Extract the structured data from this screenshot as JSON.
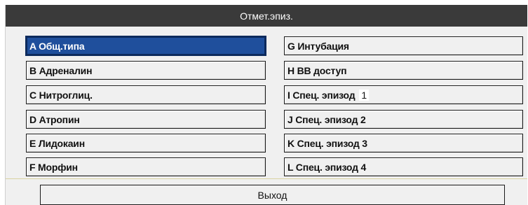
{
  "dialog": {
    "title": "Отмет.эпиз.",
    "left_buttons": [
      {
        "label": "A Общ.типа",
        "selected": true
      },
      {
        "label": "B Адреналин"
      },
      {
        "label": "C Нитроглиц."
      },
      {
        "label": "D Атропин"
      },
      {
        "label": "E Лидокаин"
      },
      {
        "label": "F Морфин"
      }
    ],
    "right_buttons": [
      {
        "label": "G Интубация"
      },
      {
        "label": "H ВВ доступ"
      },
      {
        "label": "I  Спец. эпизод",
        "badge": "1"
      },
      {
        "label": "J Спец. эпизод 2"
      },
      {
        "label": "K Спец. эпизод 3"
      },
      {
        "label": "L Спец. эпизод 4"
      }
    ],
    "exit_label": "Выход"
  },
  "colors": {
    "titlebar": "#3a3a3a",
    "selected": "#1f4f9c",
    "panel": "#f0f0f0"
  }
}
